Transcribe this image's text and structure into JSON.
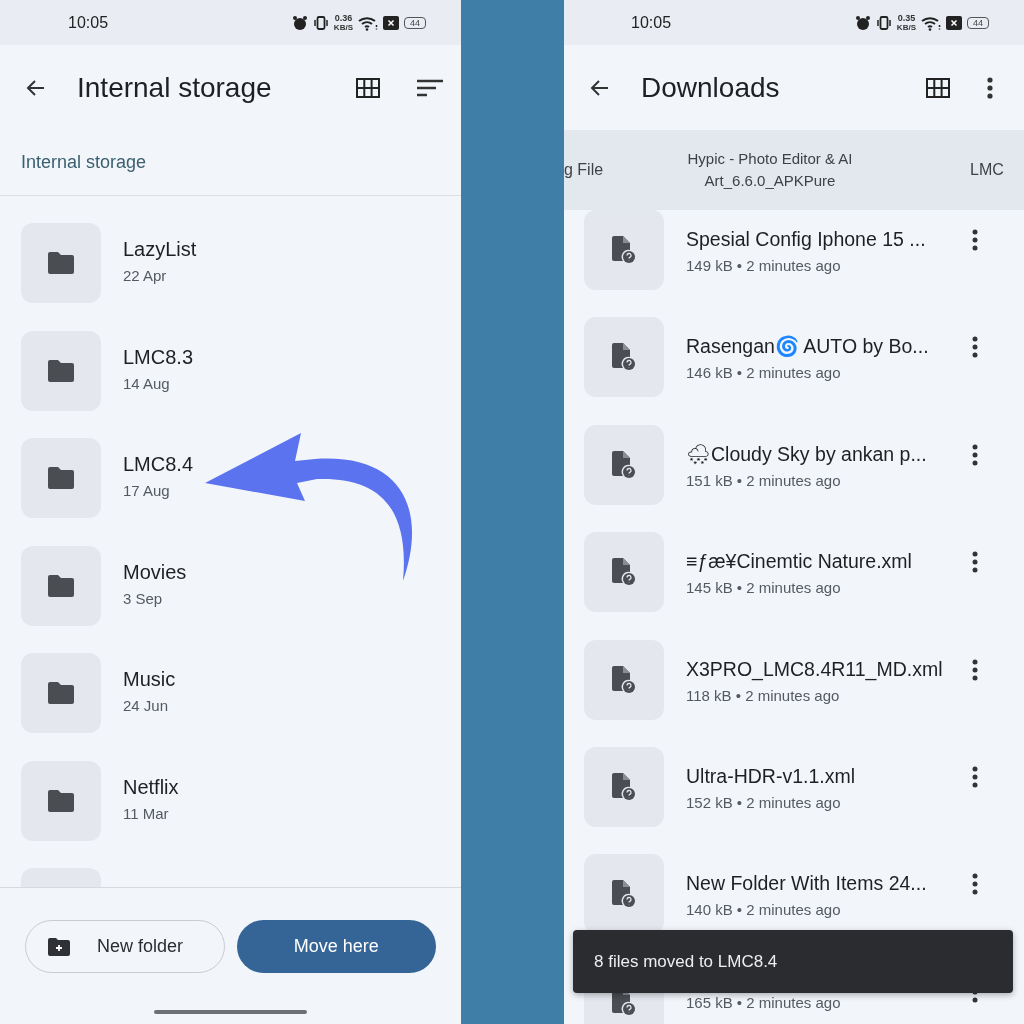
{
  "left": {
    "status_bar": {
      "time": "10:05",
      "speed": "0.36",
      "speed_unit": "KB/S",
      "battery": "44"
    },
    "title": "Internal storage",
    "breadcrumb": "Internal storage",
    "folders": [
      {
        "name": "LazyList",
        "date": "22 Apr"
      },
      {
        "name": "LMC8.3",
        "date": "14 Aug"
      },
      {
        "name": "LMC8.4",
        "date": "17 Aug"
      },
      {
        "name": "Movies",
        "date": "3 Sep"
      },
      {
        "name": "Music",
        "date": "24 Jun"
      },
      {
        "name": "Netflix",
        "date": "11 Mar"
      }
    ],
    "buttons": [
      {
        "label": "New folder",
        "kind": "outlined"
      },
      {
        "label": "Move here",
        "kind": "filled"
      }
    ]
  },
  "right": {
    "status_bar": {
      "time": "10:05",
      "speed": "0.35",
      "speed_unit": "KB/S",
      "battery": "44"
    },
    "title": "Downloads",
    "chips": [
      "g File",
      "Hypic - Photo Editor & AI Art_6.6.0_APKPure",
      "LMC"
    ],
    "files": [
      {
        "name": "Spesial Config Iphone 15 ...",
        "meta": "149 kB • 2 minutes ago"
      },
      {
        "name": "Rasengan🌀 AUTO by Bo...",
        "meta": "146 kB • 2 minutes ago"
      },
      {
        "name": "🌨Cloudy Sky by ankan p...",
        "meta": "151 kB • 2 minutes ago"
      },
      {
        "name": "≡ƒæ¥Cinemtic Nature.xml",
        "meta": "145 kB • 2 minutes ago"
      },
      {
        "name": "X3PRO_LMC8.4R11_MD.xml",
        "meta": "118 kB • 2 minutes ago"
      },
      {
        "name": "Ultra-HDR-v1.1.xml",
        "meta": "152 kB • 2 minutes ago"
      },
      {
        "name": "New Folder With Items 24...",
        "meta": "140 kB • 2 minutes ago"
      },
      {
        "meta": "165 kB • 2 minutes ago"
      }
    ],
    "toast": "8 files moved to LMC8.4"
  }
}
